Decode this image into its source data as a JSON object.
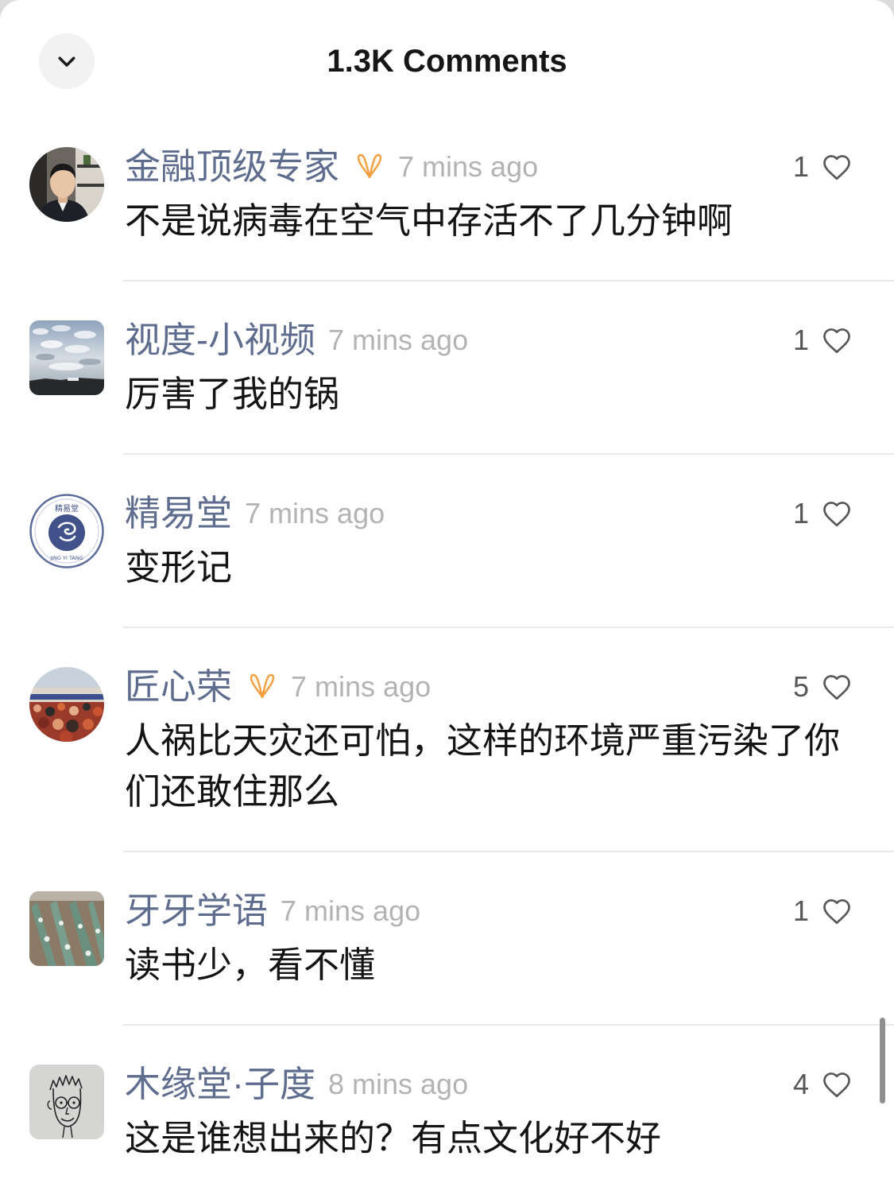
{
  "header": {
    "title": "1.3K Comments"
  },
  "icons": {
    "collapse": "chevron-down-icon",
    "like": "heart-icon",
    "badge": "verified-badge-icon"
  },
  "colors": {
    "username": "#5e6d8d",
    "text": "#141414",
    "time": "#b3b3b3",
    "likes": "#575757",
    "badge": "#f0a040",
    "divider": "#e9e9e9",
    "panel": "#ffffff"
  },
  "comments": [
    {
      "username": "金融顶级专家",
      "verified": true,
      "time": "7 mins ago",
      "likes": 1,
      "text": "不是说病毒在空气中存活不了几分钟啊"
    },
    {
      "username": "视度-小视频",
      "verified": false,
      "time": "7 mins ago",
      "likes": 1,
      "text": "厉害了我的锅"
    },
    {
      "username": "精易堂",
      "verified": false,
      "time": "7 mins ago",
      "likes": 1,
      "text": "变形记",
      "avatar_logo": {
        "top": "精易堂",
        "bottom": "JING YI TANG"
      }
    },
    {
      "username": "匠心荣",
      "verified": true,
      "time": "7 mins ago",
      "likes": 5,
      "text": "人祸比天灾还可怕，这样的环境严重污染了你们还敢住那么"
    },
    {
      "username": "牙牙学语",
      "verified": false,
      "time": "7 mins ago",
      "likes": 1,
      "text": "读书少，看不懂"
    },
    {
      "username": "木缘堂·子度",
      "verified": false,
      "time": "8 mins ago",
      "likes": 4,
      "text": "这是谁想出来的？有点文化好不好"
    }
  ]
}
